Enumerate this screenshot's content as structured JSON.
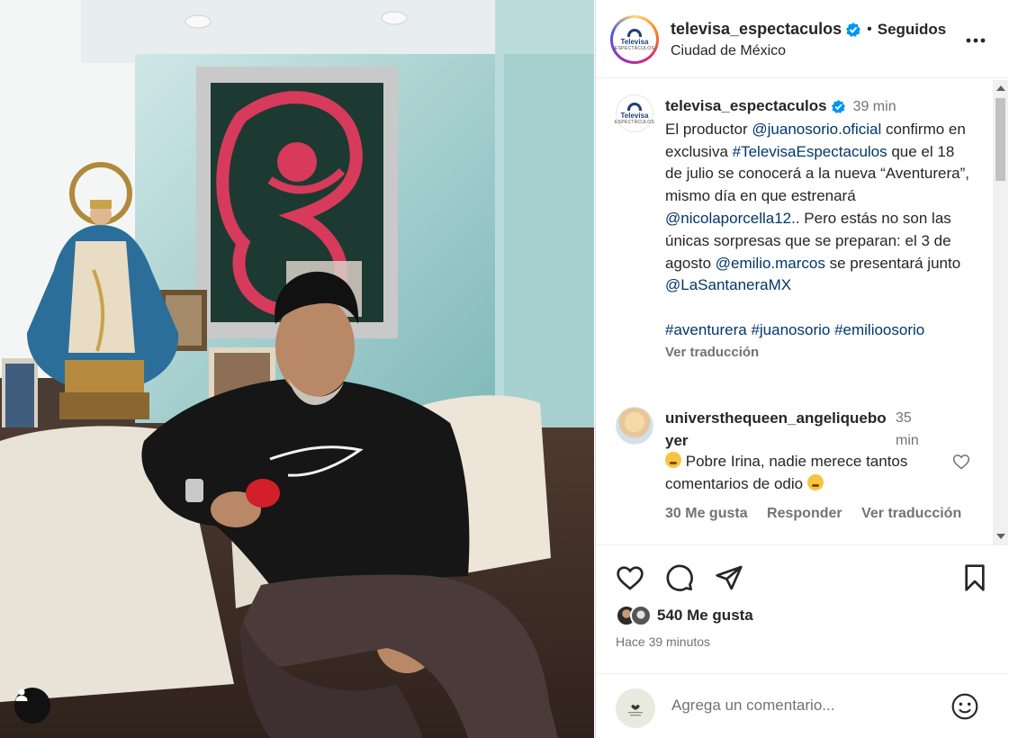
{
  "header": {
    "username": "televisa_espectaculos",
    "separator": "•",
    "follow_status": "Seguidos",
    "location": "Ciudad de México",
    "logo_text": "Televisa",
    "logo_subtext": "ESPECTÁCULOS"
  },
  "caption": {
    "username": "televisa_espectaculos",
    "time": "39 min",
    "parts": [
      {
        "t": "El productor "
      },
      {
        "link": "@juanosorio.oficial"
      },
      {
        "t": " confirmo en exclusiva "
      },
      {
        "link": "#TelevisaEspectaculos"
      },
      {
        "t": " que el 18 de julio se conocerá a la nueva “Aventurera”, mismo día en que estrenará "
      },
      {
        "link": "@nicolaporcella12"
      },
      {
        "t": ".. Pero estás no son las únicas sorpresas que se preparan: el 3 de agosto "
      },
      {
        "link": "@emilio.marcos"
      },
      {
        "t": " se presentará junto "
      },
      {
        "link": "@LaSantaneraMX"
      }
    ],
    "hashtags": [
      "#aventurera",
      "#juanosorio",
      "#emilioosorio"
    ],
    "see_translation": "Ver traducción"
  },
  "comment": {
    "username": "universthequeen_angeliqueboyer",
    "time": "35 min",
    "text": "Pobre Irina, nadie merece tantos comentarios de odio",
    "likes": "30 Me gusta",
    "reply": "Responder",
    "see_translation": "Ver traducción"
  },
  "post": {
    "likes": "540 Me gusta",
    "time_ago": "Hace 39 minutos"
  },
  "add_comment": {
    "placeholder": "Agrega un comentario..."
  },
  "colors": {
    "verified": "#0095f6",
    "link": "#00376b",
    "muted": "#737373",
    "text": "#262626"
  },
  "icons": [
    "user-tag-icon",
    "verified-icon",
    "more-icon",
    "heart-icon",
    "comment-icon",
    "share-icon",
    "bookmark-icon",
    "emoji-icon"
  ]
}
